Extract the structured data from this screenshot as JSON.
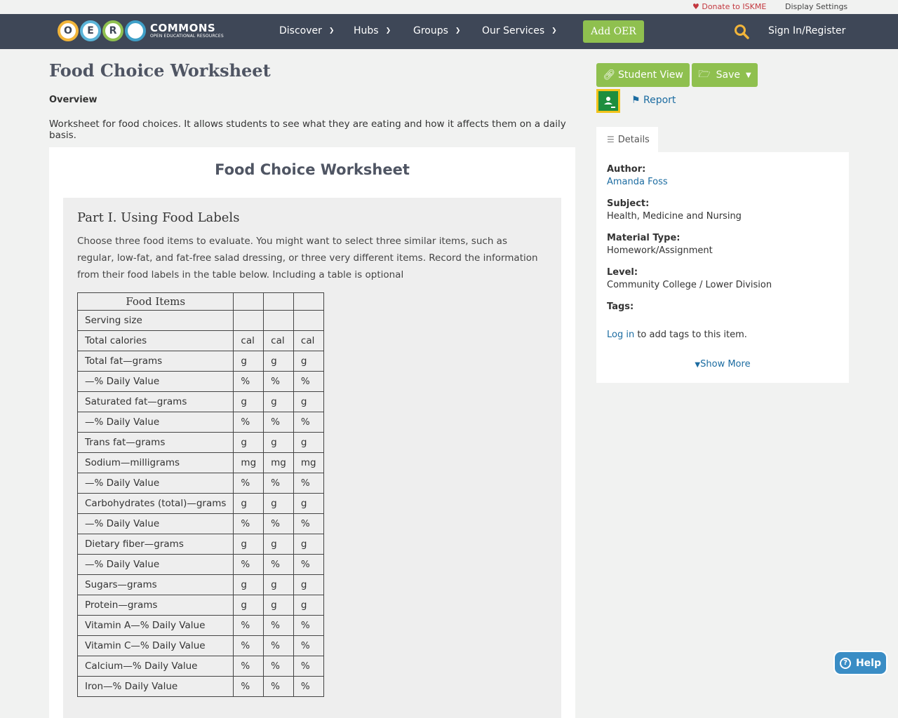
{
  "utility": {
    "donate": "Donate to ISKME",
    "display_settings": "Display Settings"
  },
  "nav": {
    "logo_letters": [
      "O",
      "E",
      "R"
    ],
    "logo_big": "COMMONS",
    "logo_small": "OPEN EDUCATIONAL RESOURCES",
    "items": [
      "Discover",
      "Hubs",
      "Groups",
      "Our Services"
    ],
    "add_oer": "Add OER",
    "signin": "Sign In/Register"
  },
  "page": {
    "title": "Food Choice Worksheet",
    "overview_label": "Overview",
    "overview_text": "Worksheet for food choices. It allows students to see what they are eating and how it affects them on a daily basis."
  },
  "content": {
    "title": "Food Choice Worksheet",
    "part_heading": "Part I. Using Food Labels",
    "part_text": "Choose three food items to evaluate. You might want to select three similar items, such as regular, low-fat, and fat-free salad dressing, or three very different items. Record the information from their food labels in the table below. Including a table is optional",
    "table_header": "Food Items",
    "rows": [
      {
        "name": "Serving size",
        "unit": ""
      },
      {
        "name": "Total calories",
        "unit": "cal"
      },
      {
        "name": "Total fat—grams",
        "unit": "g"
      },
      {
        "name": "—% Daily Value",
        "unit": "%"
      },
      {
        "name": "Saturated fat—grams",
        "unit": "g"
      },
      {
        "name": "—% Daily Value",
        "unit": "%"
      },
      {
        "name": "Trans fat—grams",
        "unit": "g"
      },
      {
        "name": "Sodium—milligrams",
        "unit": "mg"
      },
      {
        "name": "—% Daily Value",
        "unit": "%"
      },
      {
        "name": "Carbohydrates (total)—grams",
        "unit": "g"
      },
      {
        "name": "—% Daily Value",
        "unit": "%"
      },
      {
        "name": "Dietary fiber—grams",
        "unit": "g"
      },
      {
        "name": "—% Daily Value",
        "unit": "%"
      },
      {
        "name": "Sugars—grams",
        "unit": "g"
      },
      {
        "name": "Protein—grams",
        "unit": "g"
      },
      {
        "name": "Vitamin A—% Daily Value",
        "unit": "%"
      },
      {
        "name": "Vitamin C—% Daily Value",
        "unit": "%"
      },
      {
        "name": "Calcium—% Daily Value",
        "unit": "%"
      },
      {
        "name": "Iron—% Daily Value",
        "unit": "%"
      }
    ]
  },
  "sidebar": {
    "student_view": "Student View",
    "save": "Save",
    "report": "Report",
    "details_tab": "Details",
    "author_label": "Author:",
    "author": "Amanda Foss",
    "subject_label": "Subject:",
    "subject": "Health, Medicine and Nursing",
    "material_label": "Material Type:",
    "material": "Homework/Assignment",
    "level_label": "Level:",
    "level": "Community College / Lower Division",
    "tags_label": "Tags:",
    "login_link": "Log in",
    "login_rest": " to add tags to this item.",
    "show_more": "Show More"
  },
  "help": "Help",
  "colors": {
    "nav_bg": "#3e4757",
    "accent_green": "#8fc04f",
    "link": "#1c6ca1",
    "donate_red": "#c3383f"
  }
}
